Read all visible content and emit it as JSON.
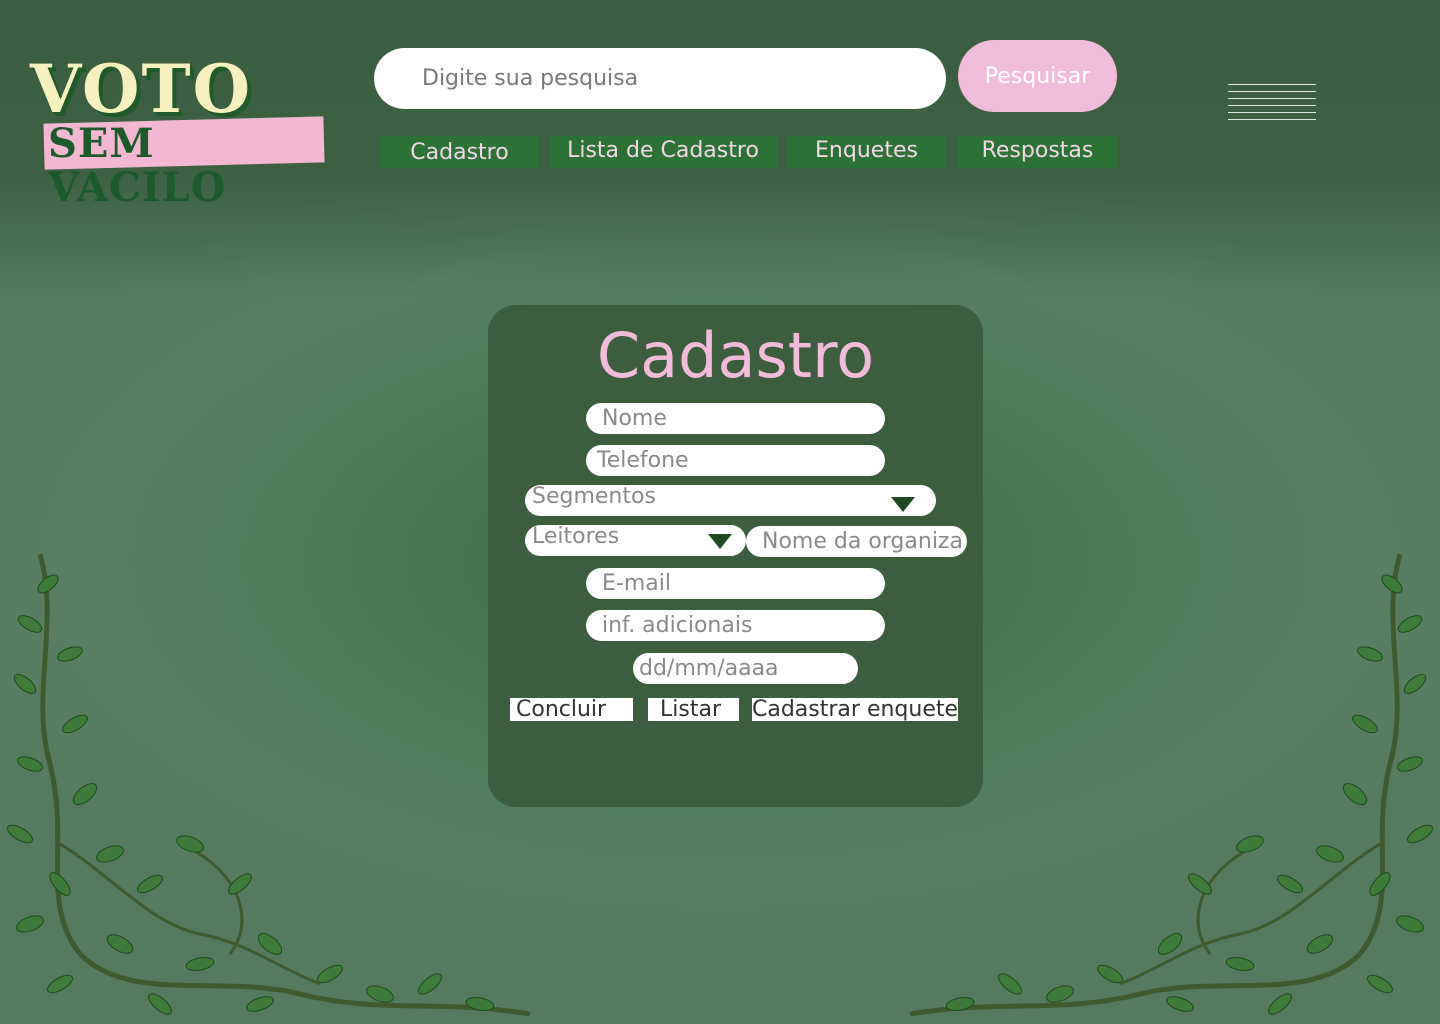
{
  "brand": {
    "line1": "VOTO",
    "line2": "SEM VACILO"
  },
  "search": {
    "placeholder": "Digite sua pesquisa",
    "button": "Pesquisar"
  },
  "menu": {
    "icon": "hamburger-menu-icon"
  },
  "nav": [
    {
      "label": "Cadastro"
    },
    {
      "label": "Lista de Cadastro"
    },
    {
      "label": "Enquetes"
    },
    {
      "label": "Respostas"
    }
  ],
  "form": {
    "title": "Cadastro",
    "nome": "Nome",
    "telefone": "Telefone",
    "segmentos": "Segmentos",
    "leitores": "Leitores",
    "organizacao": "Nome da organiza",
    "email": "E-mail",
    "info": "inf. adicionais",
    "data": "dd/mm/aaaa",
    "concluir": "Concluir",
    "listar": "Listar",
    "cadastrar_enquete": "Cadastrar enquete"
  },
  "colors": {
    "accent_pink": "#f1bcd9",
    "nav_green": "#2c7237",
    "card_green": "#3d5e3e"
  },
  "decor": {
    "left_vine": "leafy-vine-icon",
    "right_vine": "leafy-vine-icon"
  }
}
